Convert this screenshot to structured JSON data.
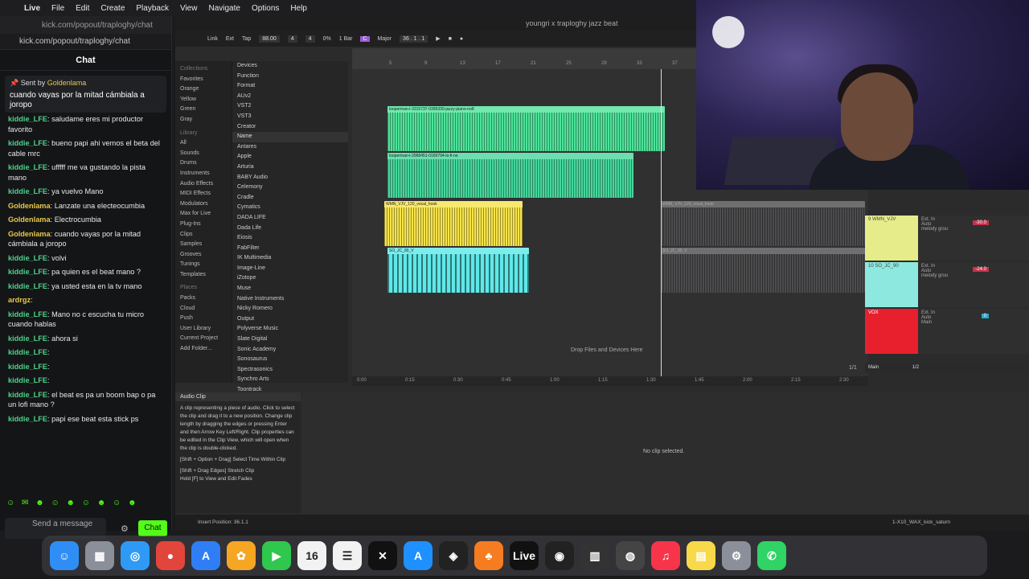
{
  "menubar": {
    "apple": "",
    "items": [
      "Live",
      "File",
      "Edit",
      "Create",
      "Playback",
      "View",
      "Navigate",
      "Options",
      "Help"
    ]
  },
  "chat_window": {
    "tab_title": "kick.com/popout/traploghy/chat",
    "url": "kick.com/popout/traploghy/chat",
    "header": "Chat",
    "pinned": {
      "sent_by_prefix": "Sent by",
      "sent_by_user": "Goldenlama",
      "message": "cuando vayas por la mitad cámbiala a joropo"
    },
    "messages": [
      {
        "user": "kiddie_LFE",
        "text": "saludame eres mi productor favorito",
        "color": "#4fd18b"
      },
      {
        "user": "kiddie_LFE",
        "text": "bueno papi ahi vemos el beta del cable mrc",
        "color": "#4fd18b"
      },
      {
        "user": "kiddie_LFE",
        "text": "ufffff me va gustando la pista mano",
        "color": "#4fd18b"
      },
      {
        "user": "kiddie_LFE",
        "text": "ya vuelvo Mano",
        "color": "#4fd18b"
      },
      {
        "user": "Goldenlama",
        "text": "Lanzate una electeocumbia",
        "color": "#e6c94a"
      },
      {
        "user": "Goldenlama",
        "text": "Electrocumbia",
        "color": "#e6c94a"
      },
      {
        "user": "Goldenlama",
        "text": "cuando vayas por la mitad cámbiala a joropo",
        "color": "#e6c94a"
      },
      {
        "user": "kiddie_LFE",
        "text": "volvi",
        "color": "#4fd18b"
      },
      {
        "user": "kiddie_LFE",
        "text": "pa quien es el beat mano ?",
        "color": "#4fd18b"
      },
      {
        "user": "kiddie_LFE",
        "text": "ya usted esta en la tv mano",
        "color": "#4fd18b"
      },
      {
        "user": "ardrgz",
        "text": "",
        "color": "#e6c94a"
      },
      {
        "user": "kiddie_LFE",
        "text": "Mano no c escucha tu micro cuando hablas",
        "color": "#4fd18b"
      },
      {
        "user": "kiddie_LFE",
        "text": "ahora si",
        "color": "#4fd18b"
      },
      {
        "user": "kiddie_LFE",
        "text": "",
        "color": "#4fd18b"
      },
      {
        "user": "kiddie_LFE",
        "text": "",
        "color": "#4fd18b"
      },
      {
        "user": "kiddie_LFE",
        "text": "",
        "color": "#4fd18b"
      },
      {
        "user": "kiddie_LFE",
        "text": "el beat es pa un boom bap o pa un lofi mano ?",
        "color": "#4fd18b"
      },
      {
        "user": "kiddie_LFE",
        "text": "papi ese beat esta stick ps",
        "color": "#4fd18b"
      }
    ],
    "input_placeholder": "Send a message",
    "send_label": "Chat"
  },
  "ableton": {
    "title": "youngri x traploghy jazz beat",
    "transport": {
      "link": "Link",
      "ext": "Ext",
      "tap": "Tap",
      "tempo": "88.00",
      "sig_num": "4",
      "sig_den": "4",
      "percent": "0%",
      "quant": "1 Bar",
      "key": "C",
      "scale": "Major",
      "position": "36 . 1 . 1"
    },
    "browser": {
      "collections_header": "Collections",
      "collections": [
        "Favorites",
        "Orange",
        "Yellow",
        "Green",
        "Gray"
      ],
      "library_header": "Library",
      "library": [
        "All",
        "Sounds",
        "Drums",
        "Instruments",
        "Audio Effects",
        "MIDI Effects",
        "Modulators",
        "Max for Live",
        "Plug-Ins",
        "Clips",
        "Samples",
        "Grooves",
        "Tunings",
        "Templates"
      ],
      "places_header": "Places",
      "places": [
        "Packs",
        "Cloud",
        "Push",
        "User Library",
        "Current Project",
        "Add Folder..."
      ],
      "filters": [
        "Devices",
        "Function",
        "Format",
        "AUv2",
        "VST2",
        "VST3",
        "Creator"
      ],
      "list_header": "Name",
      "list": [
        "Antares",
        "Apple",
        "Arturia",
        "BABY Audio",
        "Celemony",
        "Cradle",
        "Cymatics",
        "DADA LIFE",
        "Dada Life",
        "Eiosis",
        "FabFilter",
        "IK Multimedia",
        "Image-Line",
        "iZotope",
        "Muse",
        "Native Instruments",
        "Nicky Romero",
        "Output",
        "Polyverse Music",
        "Slate Digital",
        "Sonic Academy",
        "Sonosaurus",
        "Spectrasonics",
        "Synchro Arts",
        "Toontrack"
      ]
    },
    "ruler_bars": [
      "5",
      "9",
      "13",
      "17",
      "21",
      "25",
      "29",
      "33",
      "37"
    ],
    "time_ticks": [
      "0:00",
      "0:15",
      "0:30",
      "0:45",
      "1:00",
      "1:15",
      "1:30",
      "1:45",
      "2:00",
      "2:15",
      "2:30"
    ],
    "clips": {
      "track1": "looperman-l-3315737-0399330-jazzy-piano-no8",
      "track2": "looperman-l-2968451-0169794-lo-fi-ne",
      "track3": "WMN_VJV_120_vocal_hook",
      "track4": "SO_JC_90_V"
    },
    "drop_label": "Drop Files and Devices Here",
    "tracks": [
      {
        "name": "9 WMN_VJV",
        "input": "Ext. In",
        "mon": "Auto",
        "out": "melody grou",
        "vol": "-30.0"
      },
      {
        "name": "10 SO_JC_90",
        "input": "Ext. In",
        "mon": "Auto",
        "out": "melody grou",
        "vol": "-24.0"
      },
      {
        "name": "VOX",
        "input": "Ext. In",
        "mon": "Auto",
        "out": "Main",
        "vol": "0"
      }
    ],
    "main_label": "Main",
    "page_indicator": "1/1",
    "half": "1/2",
    "info_panel": {
      "title": "Audio Clip",
      "body": "A clip representing a piece of audio. Click to select the clip and drag it to a new position. Change clip length by dragging the edges or pressing Enter and then Arrow Key Left/Right. Clip properties can be edited in the Clip View, which will open when the clip is double-clicked.",
      "shortcuts": [
        "[Shift + Option + Drag] Select Time Within Clip",
        "[Shift + Drag Edges] Stretch Clip",
        "Hold [F] to View and Edit Fades"
      ]
    },
    "no_clip": "No clip selected.",
    "status_insert": "Insert Position: 36.1.1",
    "status_file": "1-X10_WAX_kick_saturn"
  },
  "dock": [
    {
      "name": "finder",
      "glyph": "☺",
      "color": "#2f8ef5"
    },
    {
      "name": "launchpad",
      "glyph": "▦",
      "color": "#8a8f99"
    },
    {
      "name": "safari",
      "glyph": "◎",
      "color": "#2f9af5"
    },
    {
      "name": "chrome",
      "glyph": "●",
      "color": "#e2453c"
    },
    {
      "name": "app-store-connect",
      "glyph": "A",
      "color": "#2f7ef5"
    },
    {
      "name": "photos",
      "glyph": "✿",
      "color": "#f5a623"
    },
    {
      "name": "facetime",
      "glyph": "▶",
      "color": "#2fc74d"
    },
    {
      "name": "calendar",
      "glyph": "16",
      "color": "#f2f2f2"
    },
    {
      "name": "reminders",
      "glyph": "☰",
      "color": "#f2f2f2"
    },
    {
      "name": "capcut",
      "glyph": "✕",
      "color": "#111111"
    },
    {
      "name": "app-store",
      "glyph": "A",
      "color": "#1e90ff"
    },
    {
      "name": "capcut-pro",
      "glyph": "◈",
      "color": "#222222"
    },
    {
      "name": "fl-studio",
      "glyph": "♣",
      "color": "#f57c20"
    },
    {
      "name": "ableton-live",
      "glyph": "Live",
      "color": "#111111"
    },
    {
      "name": "obs",
      "glyph": "◉",
      "color": "#222222"
    },
    {
      "name": "midi-utility",
      "glyph": "▥",
      "color": "#333333"
    },
    {
      "name": "audio-midi",
      "glyph": "◍",
      "color": "#444444"
    },
    {
      "name": "music",
      "glyph": "♫",
      "color": "#f7344a"
    },
    {
      "name": "notes",
      "glyph": "▤",
      "color": "#f7d94a"
    },
    {
      "name": "system-settings",
      "glyph": "⚙",
      "color": "#8a8f99"
    },
    {
      "name": "whatsapp",
      "glyph": "✆",
      "color": "#2fd366"
    }
  ]
}
